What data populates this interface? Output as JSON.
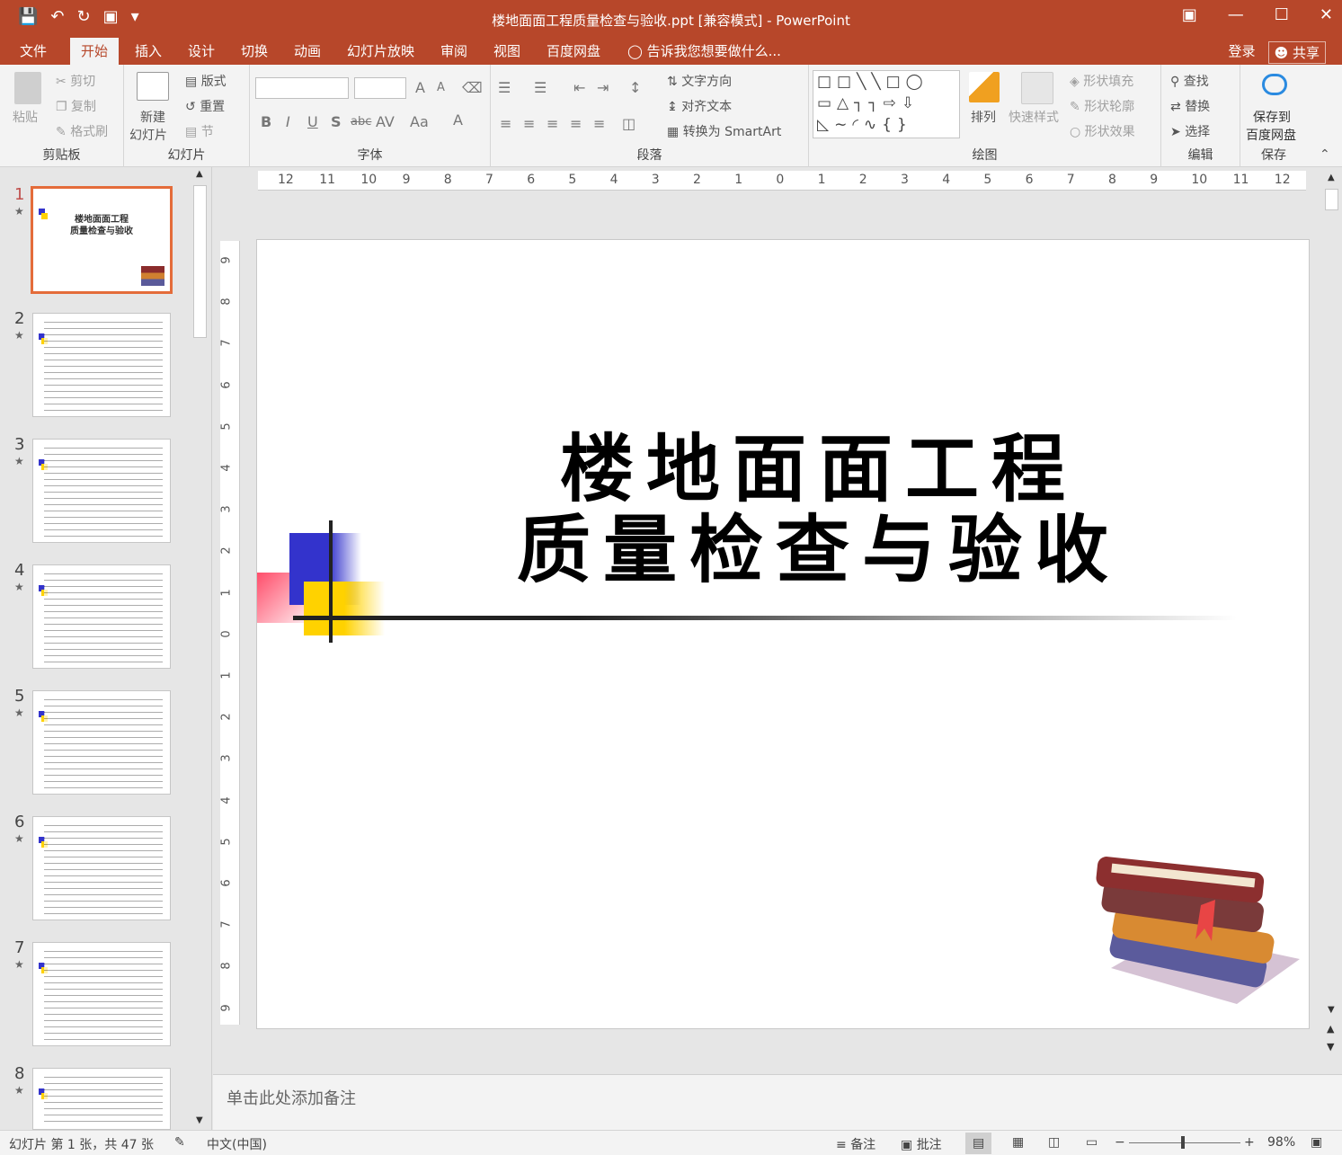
{
  "titlebar": {
    "title": "楼地面面工程质量检查与验收.ppt [兼容模式] - PowerPoint",
    "qat": [
      "save-icon",
      "undo-icon",
      "redo-icon",
      "present-icon",
      "customize-icon"
    ],
    "window_buttons": [
      "ribbon-display-icon",
      "minimize-icon",
      "maximize-icon",
      "close-icon"
    ]
  },
  "tabs": {
    "items": [
      "文件",
      "开始",
      "插入",
      "设计",
      "切换",
      "动画",
      "幻灯片放映",
      "审阅",
      "视图",
      "百度网盘"
    ],
    "active": "开始",
    "tell_me": "告诉我您想要做什么...",
    "login": "登录",
    "share": "共享"
  },
  "ribbon": {
    "clipboard": {
      "label": "剪贴板",
      "paste": "粘贴",
      "cut": "剪切",
      "copy": "复制",
      "format_painter": "格式刷"
    },
    "slides": {
      "label": "幻灯片",
      "new_slide_line1": "新建",
      "new_slide_line2": "幻灯片",
      "layout": "版式",
      "reset": "重置",
      "section": "节"
    },
    "font": {
      "label": "字体",
      "bold": "B",
      "italic": "I",
      "underline": "U",
      "shadow": "S",
      "strike": "abc",
      "spacing": "AV",
      "case": "Aa",
      "color": "A",
      "grow": "A",
      "shrink": "A"
    },
    "paragraph": {
      "label": "段落",
      "text_direction": "文字方向",
      "align_text": "对齐文本",
      "smartart": "转换为 SmartArt"
    },
    "drawing": {
      "label": "绘图",
      "arrange": "排列",
      "quick_styles": "快速样式",
      "fill": "形状填充",
      "outline": "形状轮廓",
      "effects": "形状效果"
    },
    "editing": {
      "label": "编辑",
      "find": "查找",
      "replace": "替换",
      "select": "选择"
    },
    "save": {
      "label": "保存",
      "line1": "保存到",
      "line2": "百度网盘"
    }
  },
  "slides_panel": {
    "thumbnails": [
      {
        "num": "1",
        "title_line1": "楼地面面工程",
        "title_line2": "质量检查与验收"
      },
      {
        "num": "2"
      },
      {
        "num": "3"
      },
      {
        "num": "4"
      },
      {
        "num": "5"
      },
      {
        "num": "6"
      },
      {
        "num": "7"
      },
      {
        "num": "8"
      }
    ],
    "star": "★"
  },
  "ruler": {
    "h_ticks": [
      "12",
      "11",
      "10",
      "9",
      "8",
      "7",
      "6",
      "5",
      "4",
      "3",
      "2",
      "1",
      "0",
      "1",
      "2",
      "3",
      "4",
      "5",
      "6",
      "7",
      "8",
      "9",
      "10",
      "11",
      "12"
    ],
    "v_ticks": [
      "9",
      "8",
      "7",
      "6",
      "5",
      "4",
      "3",
      "2",
      "1",
      "0",
      "1",
      "2",
      "3",
      "4",
      "5",
      "6",
      "7",
      "8",
      "9"
    ]
  },
  "slide": {
    "title_line1": "楼地面面工程",
    "title_line2": "质量检查与验收"
  },
  "notes": {
    "placeholder": "单击此处添加备注"
  },
  "statusbar": {
    "slide_info": "幻灯片 第 1 张，共 47 张",
    "language": "中文(中国)",
    "notes": "备注",
    "comments": "批注",
    "zoom": "98%"
  },
  "colors": {
    "accent": "#b7472a",
    "thumb_active": "#e46c3a"
  }
}
